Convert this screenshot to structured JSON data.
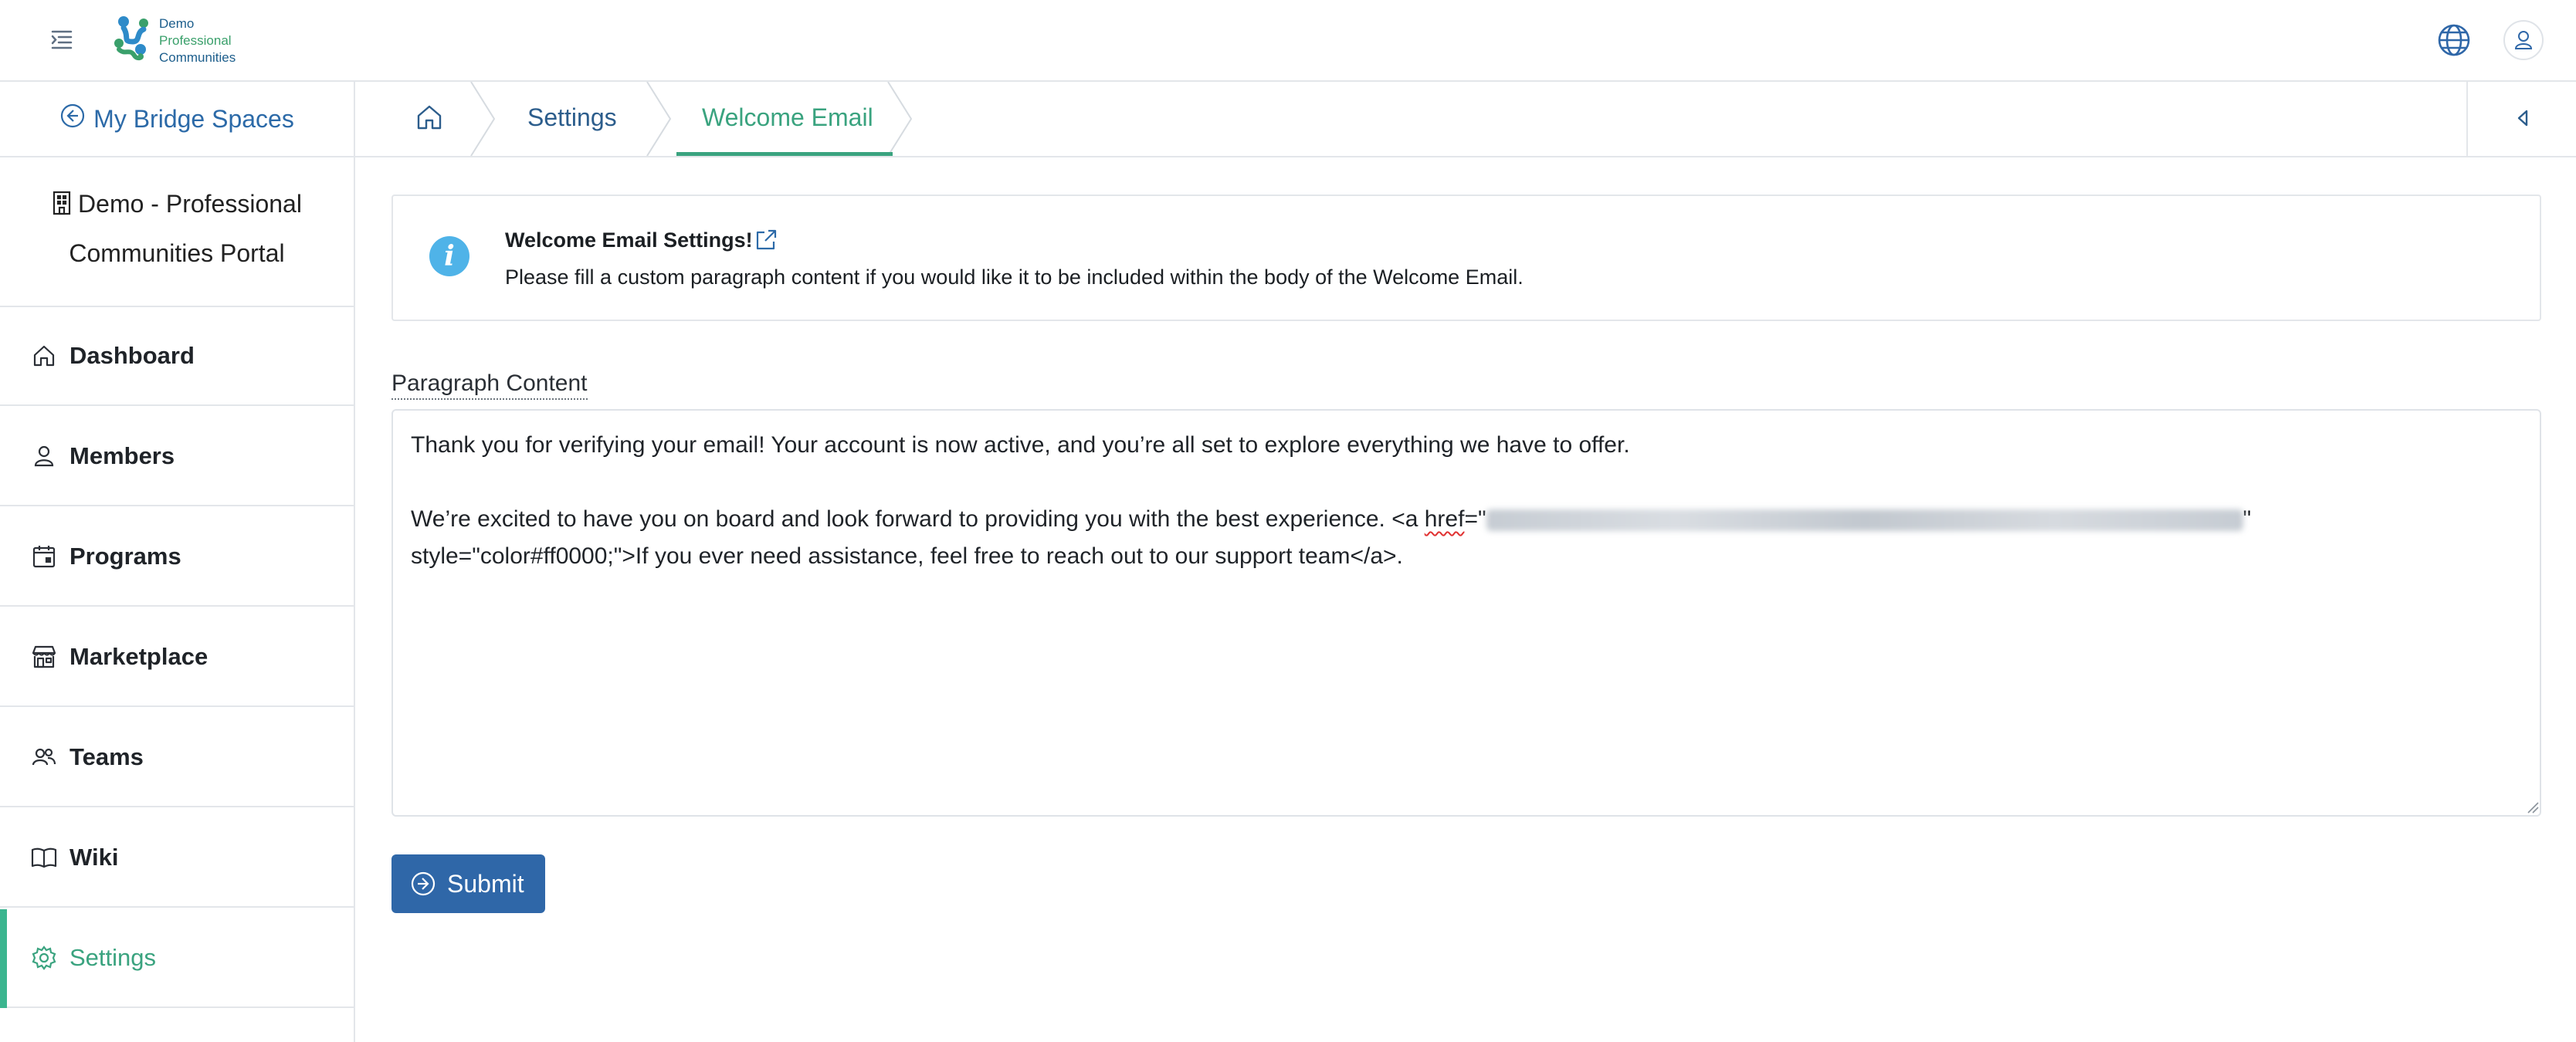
{
  "header": {
    "logo_lines": [
      "Demo",
      "Professional",
      "Communities"
    ],
    "menu_icon": "menu-indent-icon",
    "language_icon": "globe-icon",
    "user_icon": "user-icon"
  },
  "sidebar": {
    "back_label": "My Bridge Spaces",
    "portal_line1": "Demo - Professional",
    "portal_line2": "Communities Portal",
    "items": [
      {
        "label": "Dashboard",
        "icon": "home-icon",
        "active": false
      },
      {
        "label": "Members",
        "icon": "user-icon",
        "active": false
      },
      {
        "label": "Programs",
        "icon": "calendar-icon",
        "active": false
      },
      {
        "label": "Marketplace",
        "icon": "store-icon",
        "active": false
      },
      {
        "label": "Teams",
        "icon": "users-icon",
        "active": false
      },
      {
        "label": "Wiki",
        "icon": "book-icon",
        "active": false
      },
      {
        "label": "Settings",
        "icon": "gear-icon",
        "active": true
      }
    ]
  },
  "breadcrumb": {
    "items": [
      {
        "label": "",
        "icon": "home-icon"
      },
      {
        "label": "Settings"
      },
      {
        "label": "Welcome Email",
        "active": true
      }
    ]
  },
  "alert": {
    "title": "Welcome Email Settings!",
    "body": "Please fill a custom paragraph content if you would like it to be included within the body of the Welcome Email."
  },
  "form": {
    "field_label": "Paragraph Content",
    "line1": "Thank you for verifying your email! Your account is now active, and you’re all set to explore everything we have to offer.",
    "line2_prefix": "We’re excited to have you on board and look forward to providing you with the best experience. <a ",
    "line2_href": "href",
    "line2_eq": "=\"",
    "line2_suffix": "\"",
    "line3": "style=\"color#ff0000;\">If you ever need assistance, feel free to reach out to our support team</a>.",
    "submit_label": "Submit"
  },
  "colors": {
    "accent_green": "#3aa37f",
    "primary_blue": "#2f67a8",
    "info_blue": "#4fb3e8"
  }
}
